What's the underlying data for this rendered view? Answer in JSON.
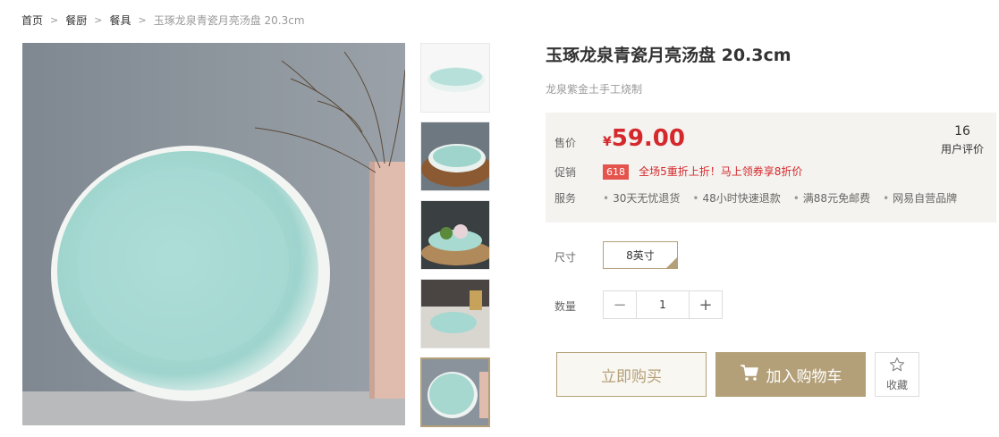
{
  "breadcrumb": {
    "items": [
      "首页",
      "餐厨",
      "餐具"
    ],
    "current": "玉琢龙泉青瓷月亮汤盘 20.3cm"
  },
  "product": {
    "title": "玉琢龙泉青瓷月亮汤盘 20.3cm",
    "subtitle": "龙泉紫金土手工烧制"
  },
  "price": {
    "label": "售价",
    "currency": "¥",
    "value": "59.00",
    "review_count": "16",
    "review_label": "用户评价"
  },
  "promo": {
    "label": "促销",
    "tag": "618",
    "text": "全场5重折上折！马上领券享8折价"
  },
  "service": {
    "label": "服务",
    "items": [
      "30天无忧退货",
      "48小时快速退款",
      "满88元免邮费",
      "网易自营品牌"
    ]
  },
  "options": {
    "size_label": "尺寸",
    "size_value": "8英寸",
    "qty_label": "数量",
    "qty_value": "1",
    "minus": "−",
    "plus": "+"
  },
  "actions": {
    "buy": "立即购买",
    "cart": "加入购物车",
    "fav": "收藏"
  },
  "colors": {
    "accent": "#b4a078",
    "price_red": "#d4282d",
    "promo_tag": "#e4534c",
    "pricebox_bg": "#f5f3ef"
  },
  "icons": [
    "chevron-right-icon",
    "cart-icon",
    "star-icon",
    "check-corner-icon"
  ]
}
